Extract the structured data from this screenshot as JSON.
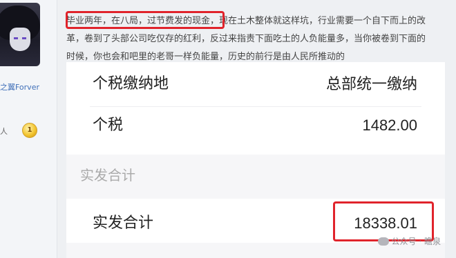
{
  "sidebar": {
    "username": "之翼Forver",
    "level_text": "人",
    "badge": "1"
  },
  "post": {
    "lines": [
      "毕业两年，在八局，过节费发的现金，现在土木整体就这样坑，行业需要一个自下而上的改",
      "革，卷到了头部公司吃仅存的红利，反过来指责下面吃土的人负能量多，当你被卷到下面的",
      "时候，你也会和吧里的老哥一样负能量，历史的前行是由人民所推动的"
    ]
  },
  "salary": {
    "rows": [
      {
        "label": "个税缴纳地",
        "value": "总部统一缴纳"
      },
      {
        "label": "个税",
        "value": "1482.00"
      }
    ],
    "section_title": "实发合计",
    "total": {
      "label": "实发合计",
      "value": "18338.01"
    }
  },
  "watermark": {
    "text": "公众号 · 瞻泉"
  },
  "colors": {
    "highlight": "#e0232b",
    "username": "#3f6fb8"
  }
}
